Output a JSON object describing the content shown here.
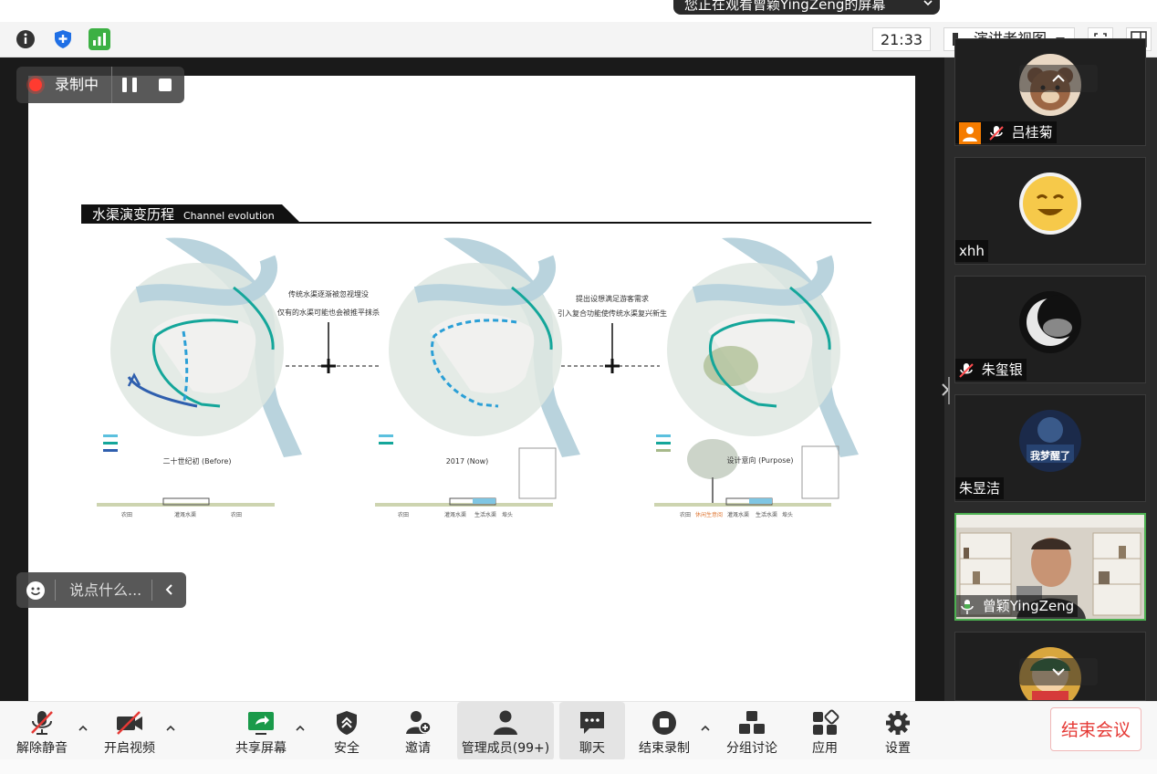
{
  "share_banner": {
    "text": "您正在观看曾颖YingZeng的屏幕"
  },
  "infobar": {
    "time": "21:33",
    "view_mode": "演讲者视图"
  },
  "recording": {
    "label": "录制中"
  },
  "chat": {
    "placeholder": "说点什么..."
  },
  "slide": {
    "section_title_cn": "水渠演变历程",
    "section_title_en": "Channel evolution",
    "note1_line1": "传统水渠逐渐被忽视埋没",
    "note1_line2": "仅有的水渠可能也会被推平抹杀",
    "note2_line1": "提出设想满足游客需求",
    "note2_line2": "引入复合功能使传统水渠复兴新生",
    "panels": [
      {
        "caption": "二十世纪初 (Before)",
        "section_labels": [
          "农田",
          "灌溉水渠",
          "农田"
        ]
      },
      {
        "caption": "2017 (Now)",
        "section_labels": [
          "农田",
          "灌溉水渠",
          "生活水渠",
          "埠头"
        ]
      },
      {
        "caption": "设计意向 (Purpose)",
        "section_labels": [
          "农田",
          "休闲生意阅",
          "灌溉水渠",
          "生活水渠",
          "埠头"
        ]
      }
    ]
  },
  "participants": [
    {
      "name": "吕桂菊",
      "muted": true,
      "avatar": "bear-avatar"
    },
    {
      "name": "xhh",
      "muted": false,
      "avatar": "smiley-avatar"
    },
    {
      "name": "朱玺银",
      "muted": true,
      "avatar": "moon-avatar"
    },
    {
      "name": "朱昱洁",
      "muted": false,
      "avatar": "text-avatar",
      "avatar_text": "我梦醒了"
    },
    {
      "name": "曾颖YingZeng",
      "muted": false,
      "active": true,
      "avatar": "video-feed"
    },
    {
      "name": "",
      "muted": false,
      "avatar": "cartoon-avatar"
    }
  ],
  "toolbar": {
    "unmute": "解除静音",
    "start_video": "开启视频",
    "share_screen": "共享屏幕",
    "security": "安全",
    "invite": "邀请",
    "participants": "管理成员(99+)",
    "chat": "聊天",
    "end_recording": "结束录制",
    "breakout": "分组讨论",
    "apps": "应用",
    "settings": "设置",
    "end_meeting": "结束会议"
  },
  "colors": {
    "channel_teal": "#14a69a",
    "channel_blue": "#2a9fd6",
    "river": "#b9d3dd",
    "end_red": "#e53935",
    "active_green": "#4caf50"
  }
}
